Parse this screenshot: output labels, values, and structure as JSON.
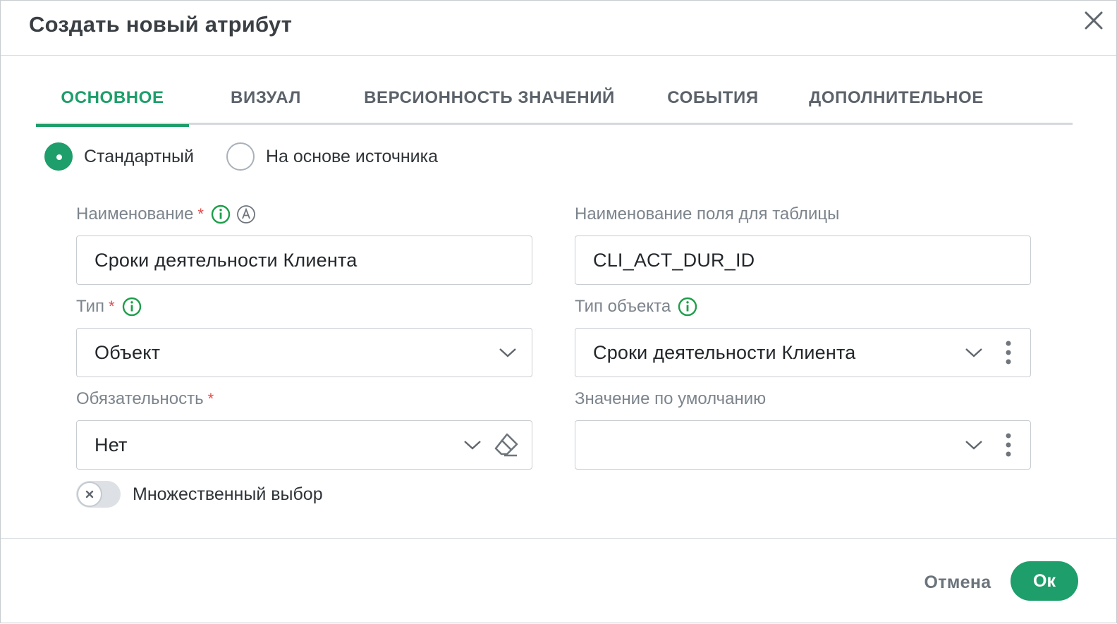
{
  "dialog": {
    "title": "Создать новый атрибут"
  },
  "tabs": [
    {
      "label": "ОСНОВНОЕ",
      "active": true
    },
    {
      "label": "ВИЗУАЛ",
      "active": false
    },
    {
      "label": "ВЕРСИОННОСТЬ ЗНАЧЕНИЙ",
      "active": false
    },
    {
      "label": "СОБЫТИЯ",
      "active": false
    },
    {
      "label": "ДОПОЛНИТЕЛЬНОЕ",
      "active": false
    }
  ],
  "source_mode": {
    "options": [
      {
        "label": "Стандартный",
        "selected": true
      },
      {
        "label": "На основе источника",
        "selected": false
      }
    ]
  },
  "form": {
    "name": {
      "label": "Наименование",
      "required_mark": "*",
      "value": "Сроки деятельности Клиента"
    },
    "table_field_name": {
      "label": "Наименование поля для таблицы",
      "value": "CLI_ACT_DUR_ID"
    },
    "type": {
      "label": "Тип",
      "required_mark": "*",
      "value": "Объект"
    },
    "object_type": {
      "label": "Тип объекта",
      "value": "Сроки деятельности Клиента"
    },
    "mandatory": {
      "label": "Обязательность",
      "required_mark": "*",
      "value": "Нет"
    },
    "default_value": {
      "label": "Значение по умолчанию",
      "value": ""
    },
    "multi_select": {
      "label": "Множественный выбор",
      "enabled": false
    }
  },
  "footer": {
    "cancel_label": "Отмена",
    "ok_label": "Ок"
  },
  "colors": {
    "accent": "#1e9e6a",
    "required": "#e04b4b",
    "label": "#7c848c",
    "border": "#c8cdd2"
  }
}
